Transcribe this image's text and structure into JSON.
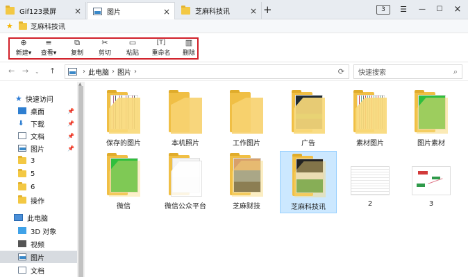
{
  "tabs": [
    {
      "label": "Gif123录屏",
      "icon": "folder-icon"
    },
    {
      "label": "图片",
      "icon": "pictures-icon"
    },
    {
      "label": "芝麻科技讯",
      "icon": "folder-icon"
    }
  ],
  "window": {
    "tab_count": "3"
  },
  "favorites": {
    "item": "芝麻科技讯"
  },
  "ribbon": {
    "buttons": [
      {
        "label": "新建",
        "icon": "new-icon",
        "glyph": "⊕",
        "dropdown": true
      },
      {
        "label": "查看",
        "icon": "view-icon",
        "glyph": "≡",
        "dropdown": true
      },
      {
        "label": "复制",
        "icon": "copy-icon",
        "glyph": "⧉"
      },
      {
        "label": "剪切",
        "icon": "cut-icon",
        "glyph": "✂"
      },
      {
        "label": "粘贴",
        "icon": "paste-icon",
        "glyph": "📋"
      },
      {
        "label": "重命名",
        "icon": "rename-icon",
        "glyph": "[T]"
      },
      {
        "label": "删除",
        "icon": "delete-icon",
        "glyph": "🗑"
      }
    ],
    "highlight_color": "#d11f28"
  },
  "address": {
    "path": [
      "此电脑",
      "图片"
    ],
    "search_placeholder": "快速搜索"
  },
  "nav": {
    "items": [
      {
        "label": "快速访问",
        "icon": "star-icon",
        "pinned": false
      },
      {
        "label": "桌面",
        "icon": "desktop-icon",
        "pinned": true
      },
      {
        "label": "下载",
        "icon": "download-icon",
        "pinned": true
      },
      {
        "label": "文档",
        "icon": "document-icon",
        "pinned": true
      },
      {
        "label": "图片",
        "icon": "pictures-icon",
        "pinned": true
      },
      {
        "label": "3",
        "icon": "folder-icon",
        "pinned": false
      },
      {
        "label": "5",
        "icon": "folder-icon",
        "pinned": false
      },
      {
        "label": "6",
        "icon": "folder-icon",
        "pinned": false
      },
      {
        "label": "操作",
        "icon": "folder-icon",
        "pinned": false
      },
      {
        "label": "此电脑",
        "icon": "computer-icon",
        "pinned": false
      },
      {
        "label": "3D 对象",
        "icon": "3d-objects-icon",
        "pinned": false
      },
      {
        "label": "视频",
        "icon": "video-icon",
        "pinned": false
      },
      {
        "label": "图片",
        "icon": "pictures-icon",
        "pinned": false,
        "selected": true
      },
      {
        "label": "文档",
        "icon": "document-icon",
        "pinned": false
      }
    ]
  },
  "files": [
    {
      "label": "保存的图片",
      "type": "folder",
      "preview": "stripes"
    },
    {
      "label": "本机照片",
      "type": "folder",
      "preview": "empty"
    },
    {
      "label": "工作图片",
      "type": "folder",
      "preview": "empty"
    },
    {
      "label": "广告",
      "type": "folder",
      "preview": "dark"
    },
    {
      "label": "素材图片",
      "type": "folder",
      "preview": "stripes"
    },
    {
      "label": "图片素材",
      "type": "folder",
      "preview": "wechat"
    },
    {
      "label": "微信",
      "type": "folder",
      "preview": "wechat"
    },
    {
      "label": "微信公众平台",
      "type": "folder",
      "preview": "light"
    },
    {
      "label": "芝麻财技",
      "type": "folder",
      "preview": "landscape"
    },
    {
      "label": "芝麻科技讯",
      "type": "folder",
      "preview": "dark",
      "selected": true
    },
    {
      "label": "2",
      "type": "image",
      "preview": "table"
    },
    {
      "label": "3",
      "type": "image",
      "preview": "mindmap"
    }
  ]
}
